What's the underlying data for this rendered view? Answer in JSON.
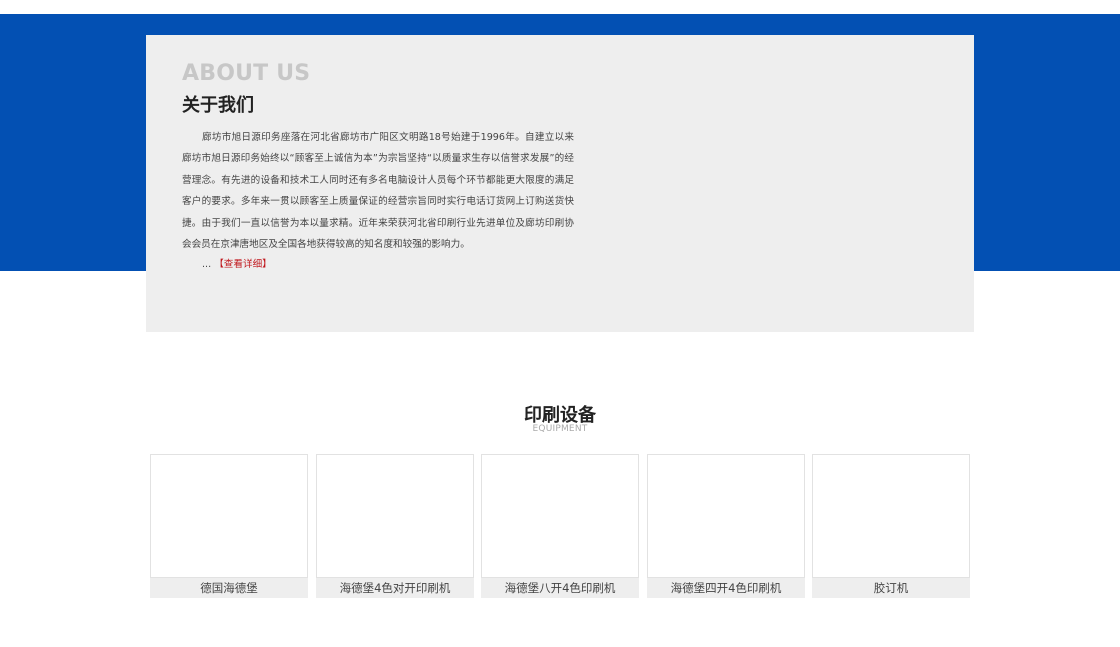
{
  "about": {
    "title_en": "ABOUT US",
    "title_cn": "关于我们",
    "body": "廊坊市旭日源印务座落在河北省廊坊市广阳区文明路18号始建于1996年。自建立以来廊坊市旭日源印务始终以“顾客至上诚信为本”为宗旨坚持“以质量求生存以信誉求发展”的经营理念。有先进的设备和技术工人同时还有多名电脑设计人员每个环节都能更大限度的满足客户的要求。多年来一贯以顾客至上质量保证的经营宗旨同时实行电话订货网上订购送货快捷。由于我们一直以信誉为本以量求精。近年来荣获河北省印刷行业先进单位及廊坊印刷协会会员在京津唐地区及全国各地获得较高的知名度和较强的影响力。",
    "ellipsis": "...",
    "more_link": "【查看详细】"
  },
  "equipment": {
    "title": "印刷设备",
    "subtitle": "EQUIPMENT",
    "items": [
      {
        "caption": "德国海德堡"
      },
      {
        "caption": "海德堡4色对开印刷机"
      },
      {
        "caption": "海德堡八开4色印刷机"
      },
      {
        "caption": "海德堡四开4色印刷机"
      },
      {
        "caption": "胶订机"
      }
    ]
  },
  "colors": {
    "brand_blue": "#0350b3",
    "card_gray": "#eeeeee",
    "link_red": "#c0161c"
  }
}
